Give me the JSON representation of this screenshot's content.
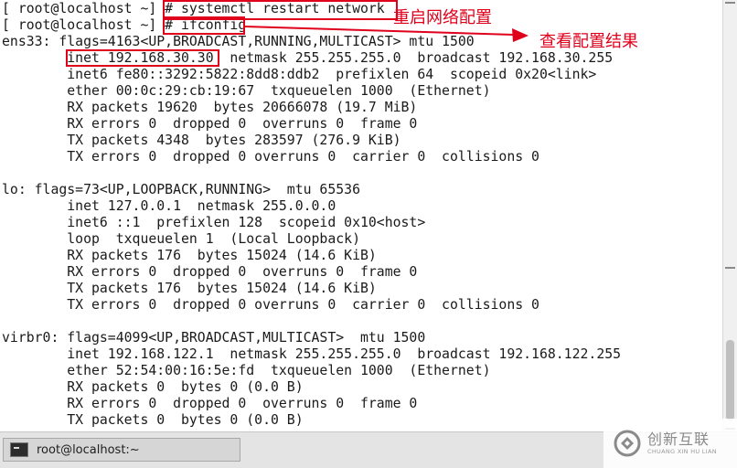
{
  "terminal": {
    "lines": [
      "[ root@localhost ~] # systemctl restart network",
      "[ root@localhost ~] # ifconfig",
      "ens33: flags=4163<UP,BROADCAST,RUNNING,MULTICAST> mtu 1500",
      "        inet 192.168.30.30  netmask 255.255.255.0  broadcast 192.168.30.255",
      "        inet6 fe80::3292:5822:8dd8:ddb2  prefixlen 64  scopeid 0x20<link>",
      "        ether 00:0c:29:cb:19:67  txqueuelen 1000  (Ethernet)",
      "        RX packets 19620  bytes 20666078 (19.7 MiB)",
      "        RX errors 0  dropped 0  overruns 0  frame 0",
      "        TX packets 4348  bytes 283597 (276.9 KiB)",
      "        TX errors 0  dropped 0 overruns 0  carrier 0  collisions 0",
      "",
      "lo: flags=73<UP,LOOPBACK,RUNNING>  mtu 65536",
      "        inet 127.0.0.1  netmask 255.0.0.0",
      "        inet6 ::1  prefixlen 128  scopeid 0x10<host>",
      "        loop  txqueuelen 1  (Local Loopback)",
      "        RX packets 176  bytes 15024 (14.6 KiB)",
      "        RX errors 0  dropped 0  overruns 0  frame 0",
      "        TX packets 176  bytes 15024 (14.6 KiB)",
      "        TX errors 0  dropped 0 overruns 0  carrier 0  collisions 0",
      "",
      "virbr0: flags=4099<UP,BROADCAST,MULTICAST>  mtu 1500",
      "        inet 192.168.122.1  netmask 255.255.255.0  broadcast 192.168.122.255",
      "        ether 52:54:00:16:5e:fd  txqueuelen 1000  (Ethernet)",
      "        RX packets 0  bytes 0 (0.0 B)",
      "        RX errors 0  dropped 0  overruns 0  frame 0",
      "        TX packets 0  bytes 0 (0.0 B)"
    ]
  },
  "annotations": {
    "restart_note": "重启网络配置",
    "result_note": "查看配置结果"
  },
  "taskbar": {
    "window_label": "root@localhost:~",
    "icon": "terminal-icon"
  },
  "watermark": {
    "brand_cn": "创新互联",
    "brand_en": "CHUANG XIN HU LIAN"
  },
  "colors": {
    "annotation": "#e0001b",
    "terminal_bg": "#ffffff",
    "terminal_text": "#1a1a1a"
  }
}
